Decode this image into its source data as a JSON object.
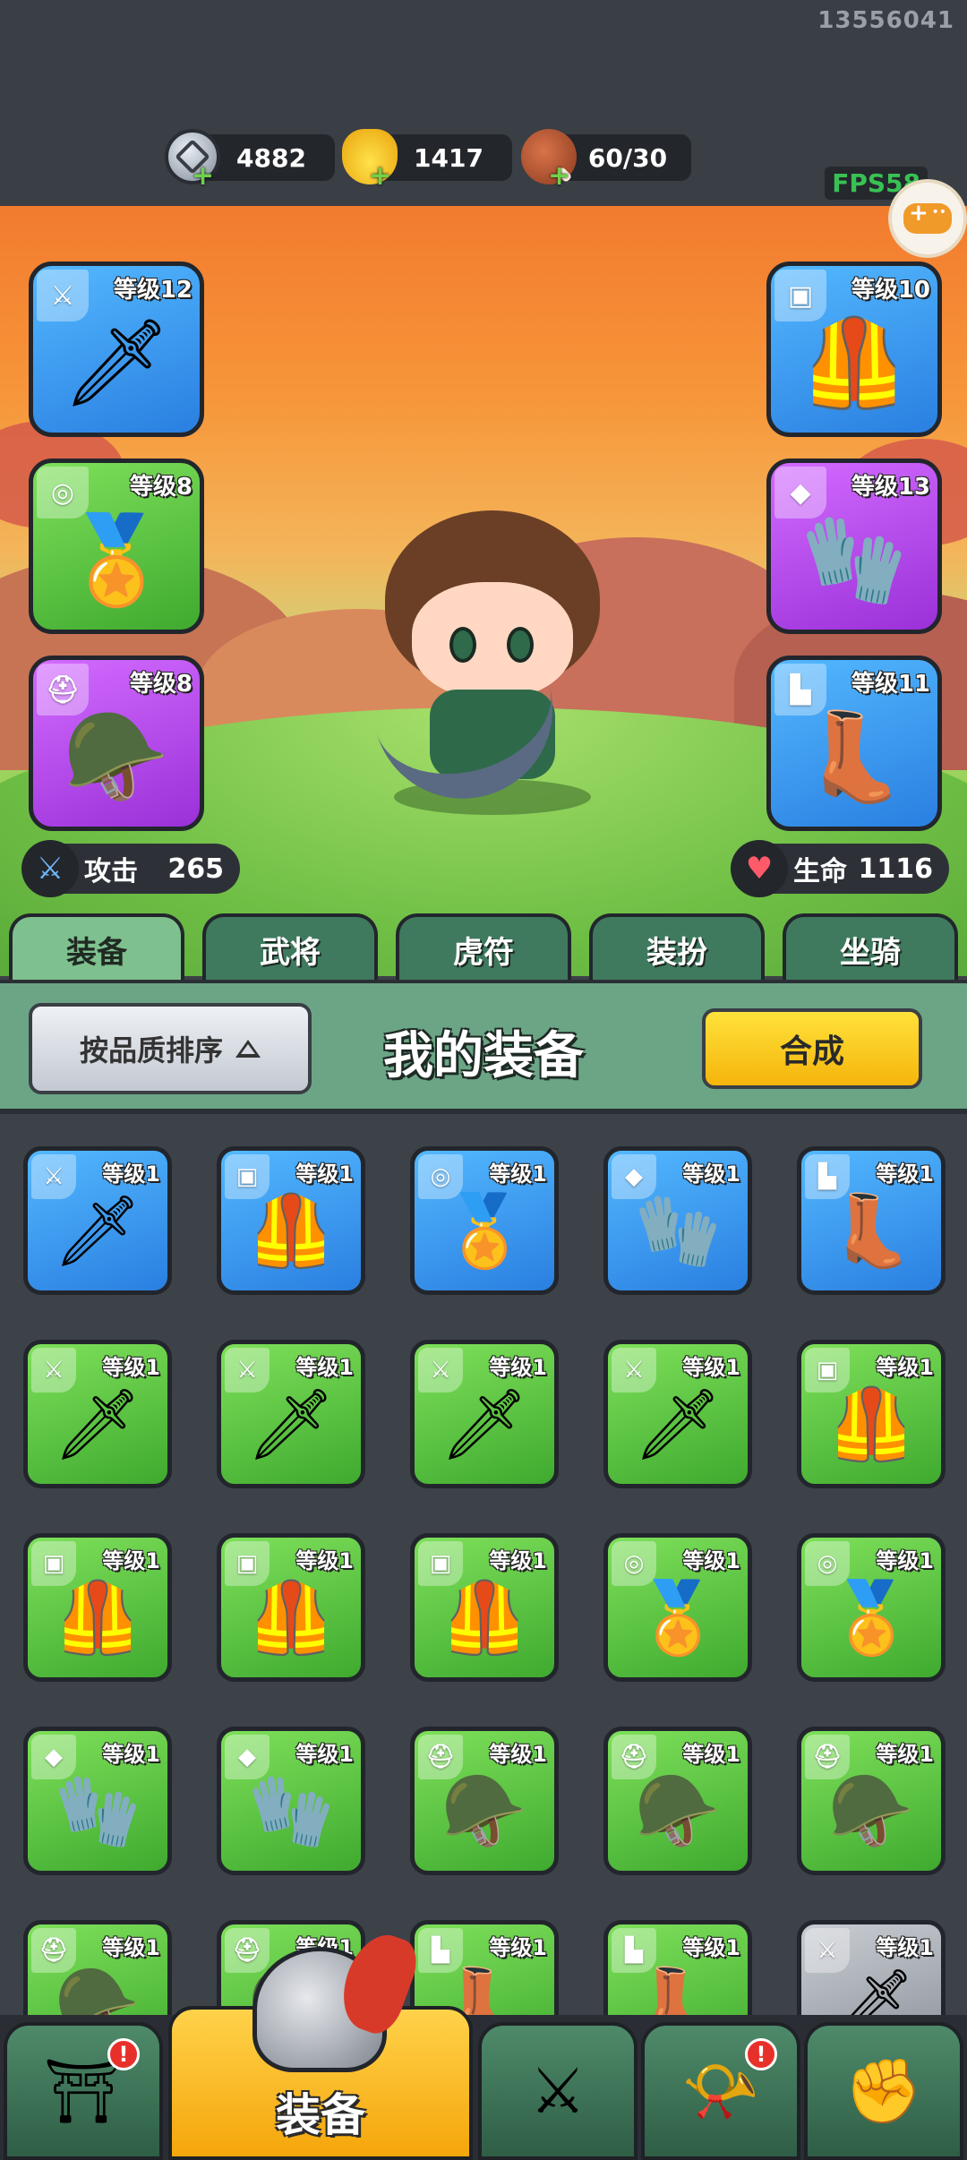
{
  "device_id": "13556041",
  "resources": [
    {
      "name": "silver",
      "icon": "silver-coin-icon",
      "value": "4882"
    },
    {
      "name": "gold",
      "icon": "gold-ingot-icon",
      "value": "1417"
    },
    {
      "name": "stamina",
      "icon": "meat-icon",
      "value": "60/30"
    }
  ],
  "fps": "FPS58",
  "equipped": {
    "weapon": {
      "level": "等级12",
      "tag_icon": "sword-icon",
      "color": "blue"
    },
    "armor": {
      "level": "等级10",
      "tag_icon": "armor-icon",
      "color": "blue"
    },
    "amulet": {
      "level": "等级8",
      "tag_icon": "medal-icon",
      "color": "green"
    },
    "gauntlet": {
      "level": "等级13",
      "tag_icon": "bracer-icon",
      "color": "purple"
    },
    "helmet": {
      "level": "等级8",
      "tag_icon": "helmet-icon",
      "color": "purple"
    },
    "boots": {
      "level": "等级11",
      "tag_icon": "boot-icon",
      "color": "blue"
    }
  },
  "stats": {
    "attack_label": "攻击",
    "attack_value": "265",
    "hp_label": "生命",
    "hp_value": "1116"
  },
  "tabs": [
    "装备",
    "武将",
    "虎符",
    "装扮",
    "坐骑"
  ],
  "active_tab": 0,
  "panel": {
    "sort_label": "按品质排序",
    "title": "我的装备",
    "merge_label": "合成"
  },
  "inventory": [
    {
      "level": "等级1",
      "type": "sword",
      "color": "blue"
    },
    {
      "level": "等级1",
      "type": "armor",
      "color": "blue"
    },
    {
      "level": "等级1",
      "type": "amulet",
      "color": "blue"
    },
    {
      "level": "等级1",
      "type": "bracer",
      "color": "blue"
    },
    {
      "level": "等级1",
      "type": "boot",
      "color": "blue"
    },
    {
      "level": "等级1",
      "type": "sword",
      "color": "green"
    },
    {
      "level": "等级1",
      "type": "sword",
      "color": "green"
    },
    {
      "level": "等级1",
      "type": "sword",
      "color": "green"
    },
    {
      "level": "等级1",
      "type": "sword",
      "color": "green"
    },
    {
      "level": "等级1",
      "type": "armor",
      "color": "green"
    },
    {
      "level": "等级1",
      "type": "armor",
      "color": "green"
    },
    {
      "level": "等级1",
      "type": "armor",
      "color": "green"
    },
    {
      "level": "等级1",
      "type": "armor",
      "color": "green"
    },
    {
      "level": "等级1",
      "type": "amulet",
      "color": "green"
    },
    {
      "level": "等级1",
      "type": "amulet",
      "color": "green"
    },
    {
      "level": "等级1",
      "type": "bracer",
      "color": "green"
    },
    {
      "level": "等级1",
      "type": "bracer",
      "color": "green"
    },
    {
      "level": "等级1",
      "type": "helmet",
      "color": "green"
    },
    {
      "level": "等级1",
      "type": "helmet",
      "color": "green"
    },
    {
      "level": "等级1",
      "type": "helmet",
      "color": "green"
    },
    {
      "level": "等级1",
      "type": "helmet",
      "color": "green"
    },
    {
      "level": "等级1",
      "type": "helmet",
      "color": "green"
    },
    {
      "level": "等级1",
      "type": "boot",
      "color": "green"
    },
    {
      "level": "等级1",
      "type": "boot",
      "color": "green"
    },
    {
      "level": "等级1",
      "type": "sword",
      "color": "gray"
    }
  ],
  "bottom_nav": {
    "active_label": "装备",
    "items": [
      {
        "icon": "shop-gate-icon",
        "badge": "!"
      },
      {
        "icon": "helmet-icon",
        "active": true
      },
      {
        "icon": "crossed-swords-icon"
      },
      {
        "icon": "horn-stars-icon",
        "badge": "!"
      },
      {
        "icon": "fist-upgrade-icon"
      }
    ]
  }
}
